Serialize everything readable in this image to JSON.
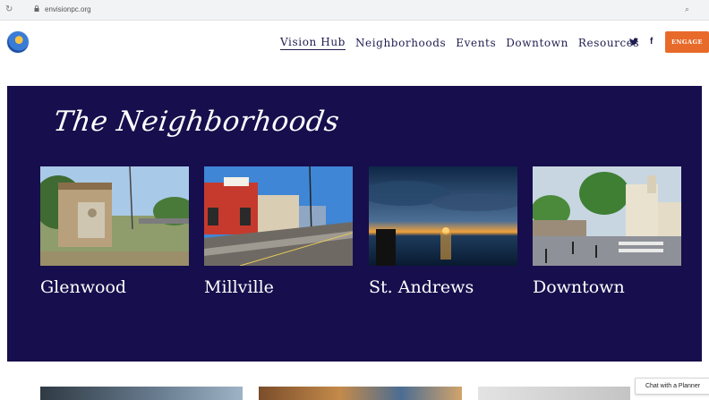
{
  "browser": {
    "url": "envisionpc.org"
  },
  "header": {
    "nav": [
      "Vision Hub",
      "Neighborhoods",
      "Events",
      "Downtown",
      "Resources"
    ],
    "social": {
      "twitter": "𝕥",
      "facebook": "f"
    },
    "engage_label": "ENGAGE"
  },
  "hero": {
    "title": "The Neighborhoods",
    "neighborhoods": [
      "Glenwood",
      "Millville",
      "St. Andrews",
      "Downtown"
    ]
  },
  "chat_label": "Chat with a Planner",
  "colors": {
    "hero_bg": "#170e4d",
    "engage_bg": "#e86a2a",
    "nav_text": "#1f1c4f",
    "page_bg": "#a9dcec"
  }
}
